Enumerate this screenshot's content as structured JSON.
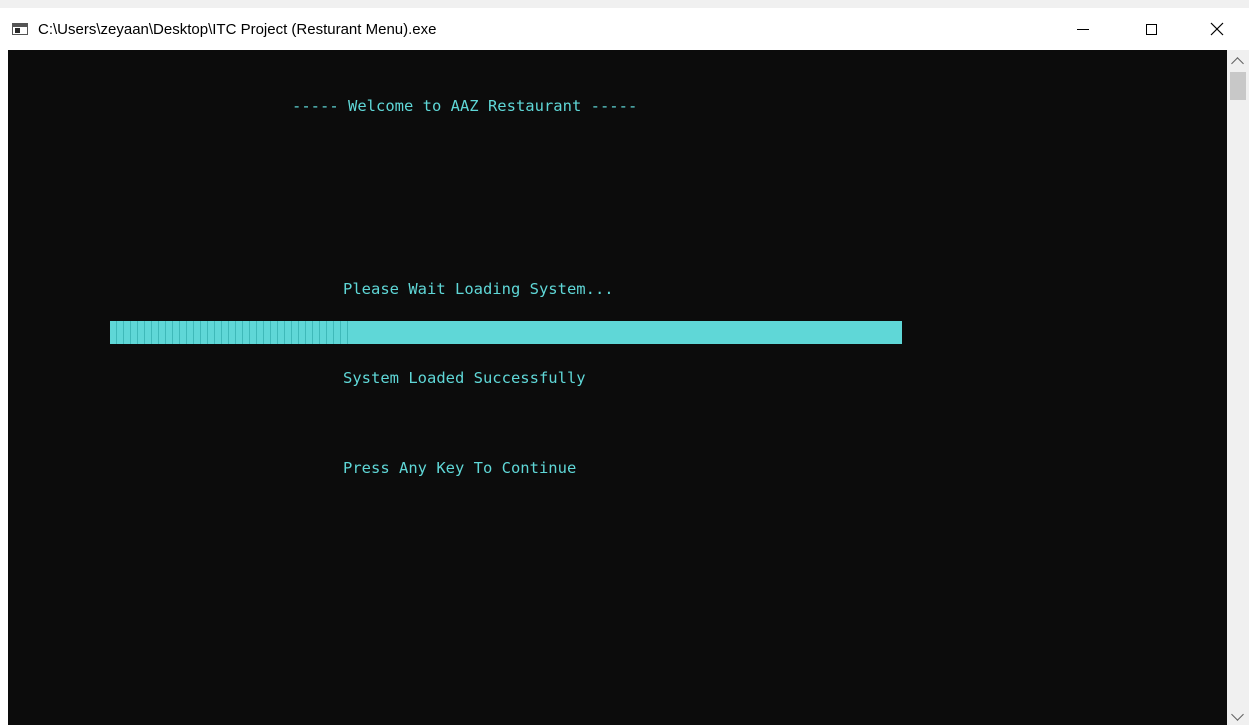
{
  "window": {
    "title": "C:\\Users\\zeyaan\\Desktop\\ITC Project (Resturant Menu).exe",
    "controls": {
      "minimize": "—",
      "maximize": "☐",
      "close": "✕"
    }
  },
  "console": {
    "welcome": "----- Welcome to AAZ Restaurant -----",
    "loading": "Please Wait Loading System...",
    "loaded": "System Loaded Successfully",
    "prompt": "Press Any Key To Continue",
    "progress_fraction": 0.3,
    "text_color": "#5fd7d7",
    "background": "#0c0c0c"
  },
  "icons": {
    "app": "console-app-icon",
    "minimize": "minimize-icon",
    "maximize": "maximize-icon",
    "close": "close-icon",
    "scroll_up": "chevron-up-icon",
    "scroll_down": "chevron-down-icon"
  }
}
